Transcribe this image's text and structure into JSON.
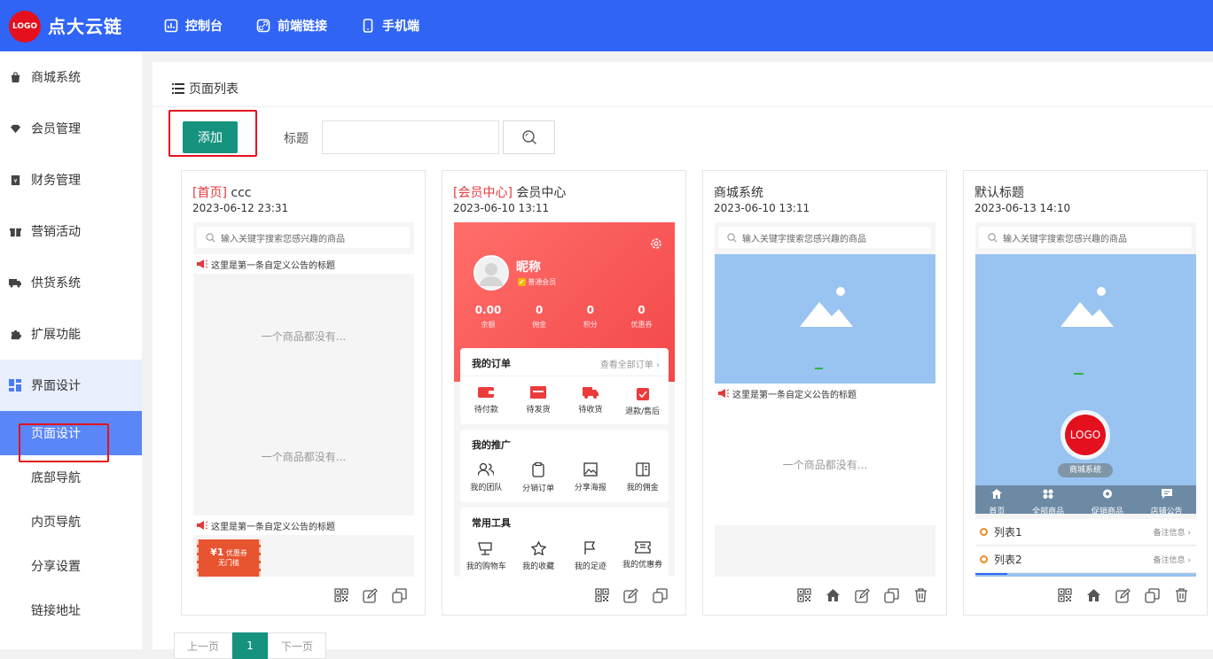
{
  "app": {
    "logo_text": "LOGO",
    "brand": "点大云链"
  },
  "topnav": [
    {
      "label": "控制台",
      "icon": "dashboard-icon"
    },
    {
      "label": "前端链接",
      "icon": "link-icon"
    },
    {
      "label": "手机端",
      "icon": "mobile-icon"
    }
  ],
  "sidebar": {
    "items": [
      {
        "label": "商城系统",
        "icon": "shopping-bag-icon"
      },
      {
        "label": "会员管理",
        "icon": "diamond-icon"
      },
      {
        "label": "财务管理",
        "icon": "finance-icon"
      },
      {
        "label": "营销活动",
        "icon": "gift-icon"
      },
      {
        "label": "供货系统",
        "icon": "truck-icon"
      },
      {
        "label": "扩展功能",
        "icon": "puzzle-icon"
      },
      {
        "label": "界面设计",
        "icon": "layout-icon"
      }
    ],
    "subitems": [
      {
        "label": "页面设计",
        "active": true
      },
      {
        "label": "底部导航"
      },
      {
        "label": "内页导航"
      },
      {
        "label": "分享设置"
      },
      {
        "label": "链接地址"
      }
    ]
  },
  "main": {
    "title": "页面列表",
    "add_label": "添加",
    "search_label": "标题",
    "search_value": ""
  },
  "cards": [
    {
      "tag": "[首页]",
      "name": "ccc",
      "date": "2023-06-12 23:31"
    },
    {
      "tag": "[会员中心]",
      "name": "会员中心",
      "date": "2023-06-10 13:11"
    },
    {
      "tag": "",
      "name": "商城系统",
      "date": "2023-06-10 13:11"
    },
    {
      "tag": "",
      "name": "默认标题",
      "date": "2023-06-13 14:10"
    }
  ],
  "preview": {
    "search_placeholder": "输入关键字搜索您感兴趣的商品",
    "notice": "这里是第一条自定义公告的标题",
    "empty": "一个商品都没有...",
    "coupon_amount": "¥1",
    "coupon_label": "优惠券",
    "coupon_sub": "无门槛"
  },
  "member_preview": {
    "nickname": "昵称",
    "level": "普通会员",
    "stats": [
      {
        "value": "0.00",
        "label": "余额"
      },
      {
        "value": "0",
        "label": "佣金"
      },
      {
        "value": "0",
        "label": "积分"
      },
      {
        "value": "0",
        "label": "优惠券"
      }
    ],
    "orders_title": "我的订单",
    "orders_more": "查看全部订单",
    "orders": [
      "待付款",
      "待发货",
      "待收货",
      "退款/售后"
    ],
    "promo_title": "我的推广",
    "promo": [
      "我的团队",
      "分销订单",
      "分享海报",
      "我的佣金"
    ],
    "tools_title": "常用工具",
    "tools": [
      "我的购物车",
      "我的收藏",
      "我的足迹",
      "我的优惠券"
    ]
  },
  "default_preview": {
    "logo_text": "LOGO",
    "shop_name": "商城系统",
    "nav": [
      "首页",
      "全部商品",
      "促销商品",
      "店铺公告"
    ],
    "list": [
      {
        "label": "列表1",
        "note": "备注信息"
      },
      {
        "label": "列表2",
        "note": "备注信息"
      }
    ]
  },
  "pager": {
    "prev": "上一页",
    "page": "1",
    "next": "下一页"
  },
  "colors": {
    "primary": "#2f64f5",
    "accent": "#16937f",
    "highlight": "#e4101e"
  }
}
